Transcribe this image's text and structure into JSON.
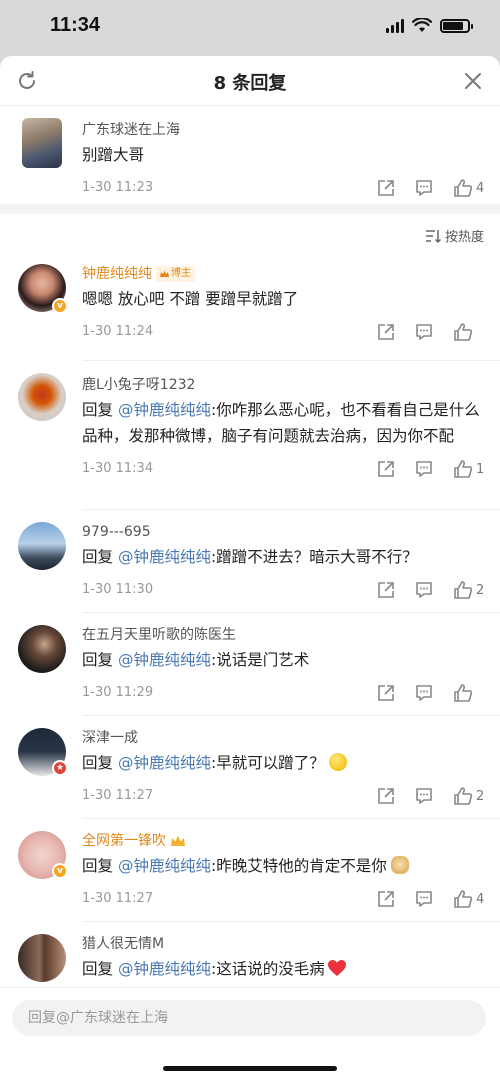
{
  "status_bar": {
    "time": "11:34"
  },
  "header": {
    "title": "8 条回复"
  },
  "root_comment": {
    "user": "广东球迷在上海",
    "text": "别蹭大哥",
    "time": "1-30 11:23",
    "likes": "4"
  },
  "sort": {
    "label": "按热度"
  },
  "replies": [
    {
      "user": "钟鹿纯纯纯",
      "tag": "博主",
      "text": "嗯嗯 放心吧 不蹭  要蹭早就蹭了",
      "time": "1-30 11:24",
      "likes": ""
    },
    {
      "user": "鹿L小兔子呀1232",
      "prefix": "回复",
      "mention": "@钟鹿纯纯纯",
      "text": ":你咋那么恶心呢，也不看看自己是什么品种，发那种微博，脑子有问题就去治病，因为你不配",
      "time": "1-30 11:34",
      "likes": "1"
    },
    {
      "user": "979---695",
      "prefix": "回复",
      "mention": "@钟鹿纯纯纯",
      "text": ":蹭蹭不进去？暗示大哥不行？",
      "time": "1-30 11:30",
      "likes": "2"
    },
    {
      "user": "在五月天里听歌的陈医生",
      "prefix": "回复",
      "mention": "@钟鹿纯纯纯",
      "text": ":说话是门艺术",
      "time": "1-30 11:29",
      "likes": ""
    },
    {
      "user": "深津一成",
      "prefix": "回复",
      "mention": "@钟鹿纯纯纯",
      "text": ":早就可以蹭了？",
      "time": "1-30 11:27",
      "likes": "2"
    },
    {
      "user": "全网第一锋吹",
      "prefix": "回复",
      "mention": "@钟鹿纯纯纯",
      "text": ":昨晚艾特他的肯定不是你",
      "time": "1-30 11:27",
      "likes": "4"
    },
    {
      "user": "猎人很无情M",
      "prefix": "回复",
      "mention": "@钟鹿纯纯纯",
      "text": ":这话说的没毛病",
      "time": "",
      "likes": ""
    }
  ],
  "input": {
    "placeholder": "回复@广东球迷在上海"
  },
  "colors": {
    "mention": "#4a78b4",
    "vip_name": "#e08a1e",
    "meta": "#999999"
  }
}
